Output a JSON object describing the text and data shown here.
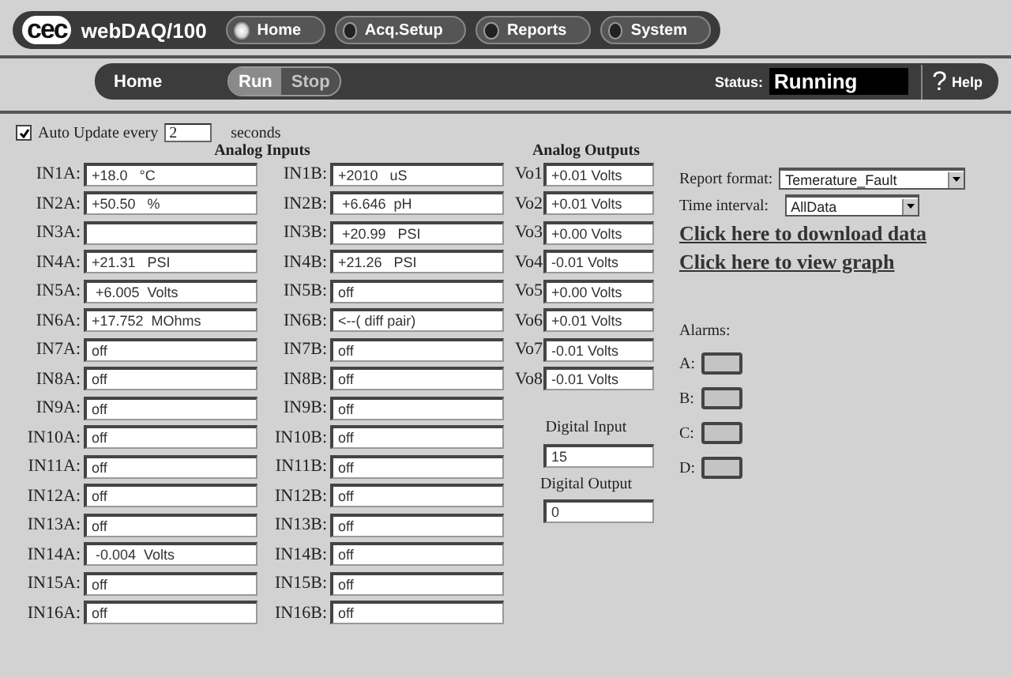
{
  "nav": {
    "logo": "cec",
    "product": "webDAQ/100",
    "tabs": [
      {
        "label": "Home",
        "selected": true
      },
      {
        "label": "Acq.Setup",
        "selected": false
      },
      {
        "label": "Reports",
        "selected": false
      },
      {
        "label": "System",
        "selected": false
      }
    ]
  },
  "toolbar": {
    "page": "Home",
    "run": {
      "label": "Run",
      "disabled": false
    },
    "stop": {
      "label": "Stop",
      "disabled": true
    },
    "status_label": "Status:",
    "status": "Running",
    "help_icon": "?",
    "help": "Help"
  },
  "auto_update": {
    "checked": true,
    "label": "Auto Update every",
    "value": "2",
    "unit": "seconds"
  },
  "analog_inputs": {
    "title": "Analog Inputs",
    "rows": [
      {
        "a_label": "IN1A:",
        "a_value": "+18.0   °C",
        "b_label": "IN1B:",
        "b_value": "+2010   uS"
      },
      {
        "a_label": "IN2A:",
        "a_value": "+50.50   %",
        "b_label": "IN2B:",
        "b_value": " +6.646  pH"
      },
      {
        "a_label": "IN3A:",
        "a_value": "",
        "b_label": "IN3B:",
        "b_value": " +20.99   PSI"
      },
      {
        "a_label": "IN4A:",
        "a_value": "+21.31   PSI",
        "b_label": "IN4B:",
        "b_value": "+21.26   PSI"
      },
      {
        "a_label": "IN5A:",
        "a_value": " +6.005  Volts",
        "b_label": "IN5B:",
        "b_value": "off"
      },
      {
        "a_label": "IN6A:",
        "a_value": "+17.752  MOhms",
        "b_label": "IN6B:",
        "b_value": "<--( diff pair)"
      },
      {
        "a_label": "IN7A:",
        "a_value": "off",
        "b_label": "IN7B:",
        "b_value": "off"
      },
      {
        "a_label": "IN8A:",
        "a_value": "off",
        "b_label": "IN8B:",
        "b_value": "off"
      },
      {
        "a_label": "IN9A:",
        "a_value": "off",
        "b_label": "IN9B:",
        "b_value": "off"
      },
      {
        "a_label": "IN10A:",
        "a_value": "off",
        "b_label": "IN10B:",
        "b_value": "off"
      },
      {
        "a_label": "IN11A:",
        "a_value": "off",
        "b_label": "IN11B:",
        "b_value": "off"
      },
      {
        "a_label": "IN12A:",
        "a_value": "off",
        "b_label": "IN12B:",
        "b_value": "off"
      },
      {
        "a_label": "IN13A:",
        "a_value": "off",
        "b_label": "IN13B:",
        "b_value": "off"
      },
      {
        "a_label": "IN14A:",
        "a_value": " -0.004  Volts",
        "b_label": "IN14B:",
        "b_value": "off"
      },
      {
        "a_label": "IN15A:",
        "a_value": "off",
        "b_label": "IN15B:",
        "b_value": "off"
      },
      {
        "a_label": "IN16A:",
        "a_value": "off",
        "b_label": "IN16B:",
        "b_value": "off"
      }
    ]
  },
  "analog_outputs": {
    "title": "Analog Outputs",
    "rows": [
      {
        "label": "Vo1",
        "value": "+0.01 Volts"
      },
      {
        "label": "Vo2",
        "value": "+0.01 Volts"
      },
      {
        "label": "Vo3",
        "value": "+0.00 Volts"
      },
      {
        "label": "Vo4",
        "value": "-0.01 Volts"
      },
      {
        "label": "Vo5",
        "value": "+0.00 Volts"
      },
      {
        "label": "Vo6",
        "value": "+0.01 Volts"
      },
      {
        "label": "Vo7",
        "value": "-0.01 Volts"
      },
      {
        "label": "Vo8",
        "value": "-0.01 Volts"
      }
    ]
  },
  "digital_input": {
    "label": "Digital Input",
    "value": "15"
  },
  "digital_output": {
    "label": "Digital Output",
    "value": "0"
  },
  "reports": {
    "format_label": "Report format:",
    "format": "Temerature_Fault",
    "interval_label": "Time interval:",
    "interval": "AllData",
    "download_link": "Click here to download data",
    "graph_link": "Click here to view graph"
  },
  "alarms": {
    "title": "Alarms:",
    "items": [
      {
        "label": "A:",
        "on": false
      },
      {
        "label": "B:",
        "on": false
      },
      {
        "label": "C:",
        "on": false
      },
      {
        "label": "D:",
        "on": false
      }
    ]
  }
}
